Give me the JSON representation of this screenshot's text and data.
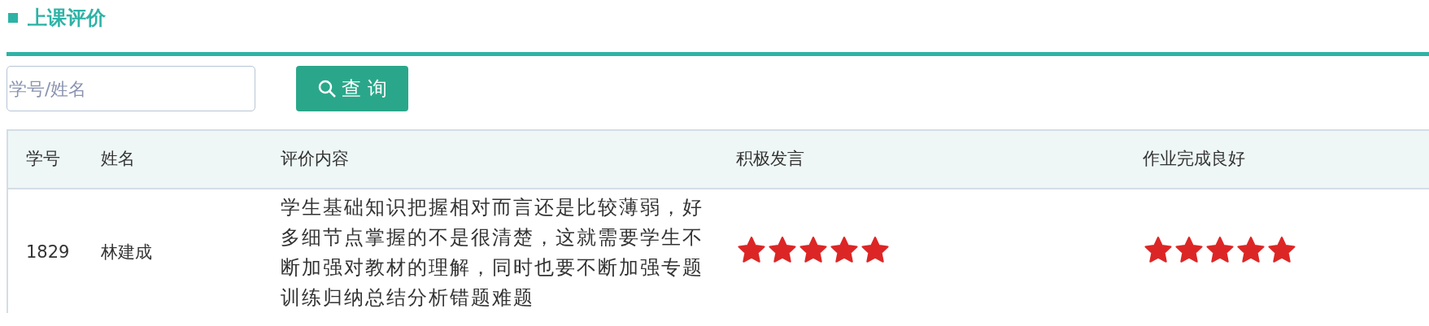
{
  "section": {
    "title": "上课评价"
  },
  "search": {
    "placeholder": "学号/姓名",
    "button": "查 询"
  },
  "table": {
    "columns": [
      "学号",
      "姓名",
      "评价内容",
      "积极发言",
      "作业完成良好"
    ],
    "rows": [
      {
        "cells": [
          "1829",
          "林建成",
          "学生基础知识把握相对而言还是比较薄弱，好多细节点掌握的不是很清楚，这就需要学生不断加强对教材的理解，同时也要不断加强专题训练归纳总结分析错题难题"
        ],
        "ratings": [
          {
            "stars": 5
          },
          {
            "stars": 5
          }
        ]
      }
    ]
  }
}
